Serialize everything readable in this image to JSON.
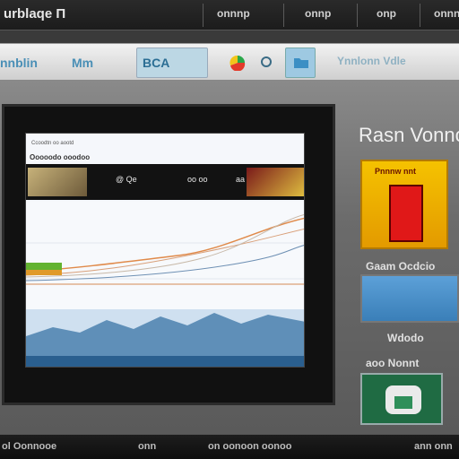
{
  "app": {
    "title": "urblaqe Π"
  },
  "menu": [
    "onnnp",
    "onnp",
    "onp",
    "onnnp"
  ],
  "toolbar": {
    "items": [
      "nnblin",
      "Mm",
      "BCA"
    ],
    "link": "Ynnlonn Vdle"
  },
  "side": {
    "title": "Rasn Vonnc",
    "promo_label": "Pnnnw nnt",
    "caption_1": "Gaam Ocdcio",
    "caption_2": "Wdodo",
    "caption_3": "aoo Nonnt"
  },
  "screen": {
    "header_1": "Ccoodtn oo aootd",
    "header_2": "Ooooodo ooodoo",
    "strip_labels": [
      "@ Qe",
      "oo oo",
      "aa"
    ]
  },
  "bottom": [
    "ol Oonnooe",
    "onn",
    "on oonoon oonoo",
    "ann onn"
  ],
  "colors": {
    "accent": "#4a8fb6",
    "promo": "#f5c200",
    "promo_red": "#e01818"
  }
}
